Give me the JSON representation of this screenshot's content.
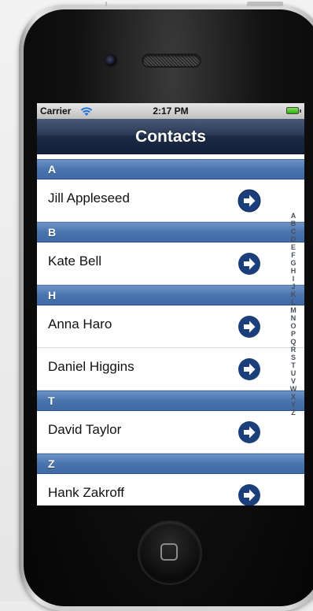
{
  "status_bar": {
    "carrier": "Carrier",
    "time": "2:17 PM"
  },
  "nav": {
    "title": "Contacts"
  },
  "sections": [
    {
      "header": "A",
      "rows": [
        "Jill Appleseed"
      ]
    },
    {
      "header": "B",
      "rows": [
        "Kate Bell"
      ]
    },
    {
      "header": "H",
      "rows": [
        "Anna Haro",
        "Daniel Higgins"
      ]
    },
    {
      "header": "T",
      "rows": [
        "David Taylor"
      ]
    },
    {
      "header": "Z",
      "rows": [
        "Hank Zakroff"
      ]
    }
  ],
  "index": [
    "A",
    "B",
    "C",
    "D",
    "E",
    "F",
    "G",
    "H",
    "I",
    "J",
    "K",
    "L",
    "M",
    "N",
    "O",
    "P",
    "Q",
    "R",
    "S",
    "T",
    "U",
    "V",
    "W",
    "X",
    "Y",
    "Z"
  ],
  "colors": {
    "nav_bar": "#1c2a44",
    "section_header": "#4a74ae",
    "disclosure": "#1b3f7a",
    "battery": "#2fae14"
  },
  "icons": {
    "wifi": "wifi-icon",
    "battery": "battery-icon",
    "disclosure": "detail-disclosure-icon"
  }
}
